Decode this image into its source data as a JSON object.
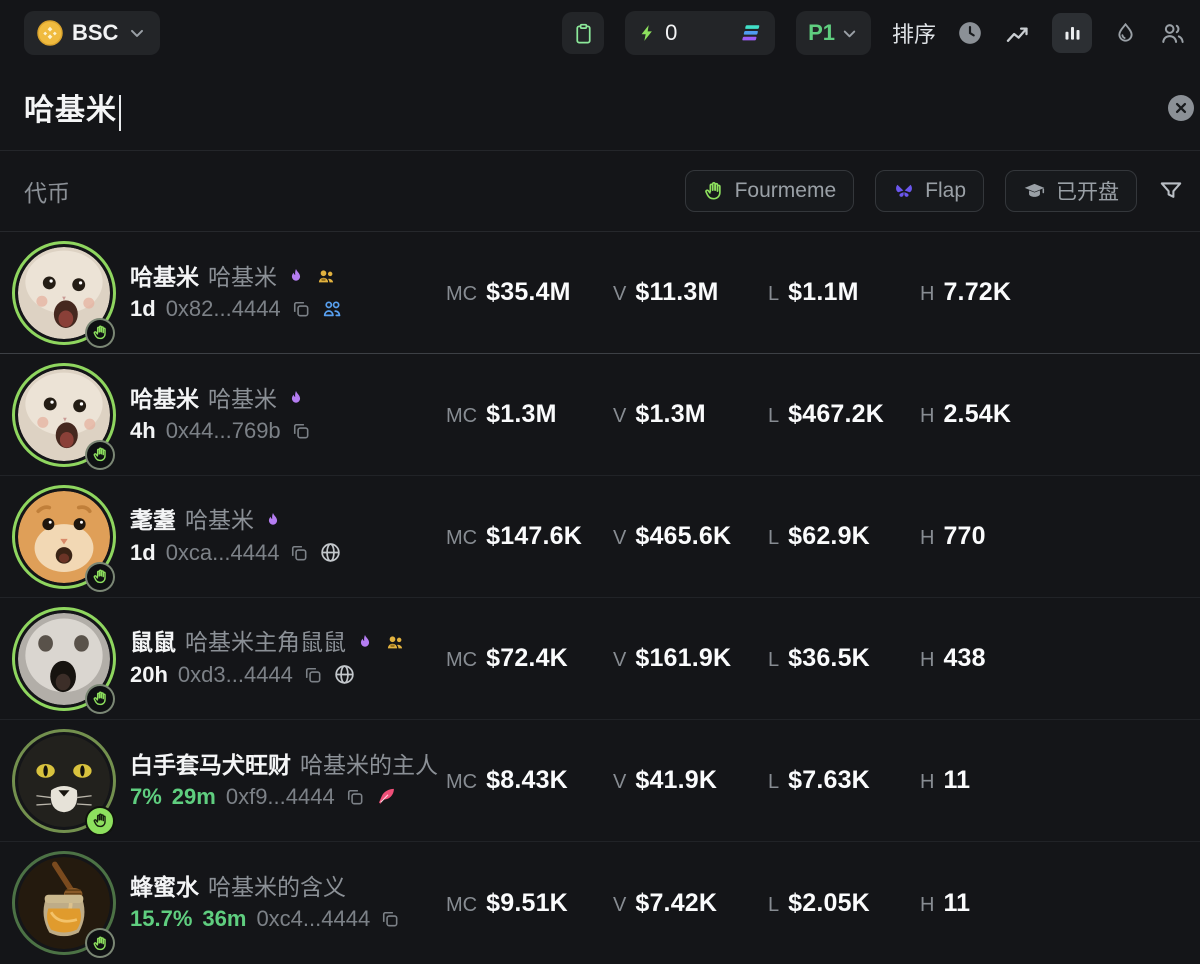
{
  "topbar": {
    "chain": "BSC",
    "boost_count": "0",
    "preset": "P1",
    "sort_label": "排序"
  },
  "search": {
    "value": "哈基米"
  },
  "section": {
    "title": "代币",
    "buttons": {
      "fourmeme": "Fourmeme",
      "flap": "Flap",
      "listed": "已开盘"
    }
  },
  "stats_labels": {
    "mc": "MC",
    "v": "V",
    "l": "L",
    "h": "H"
  },
  "tokens": [
    {
      "name": "哈基米",
      "subtitle": "哈基米",
      "age": "1d",
      "address": "0x82...4444",
      "mc": "$35.4M",
      "v": "$11.3M",
      "l": "$1.1M",
      "h": "7.72K",
      "badges": [
        "flame-icon",
        "holders-yellow-icon"
      ],
      "links": [
        "copy-icon",
        "community-blue-icon"
      ],
      "avatar": "white-cat"
    },
    {
      "name": "哈基米",
      "subtitle": "哈基米",
      "age": "4h",
      "address": "0x44...769b",
      "mc": "$1.3M",
      "v": "$1.3M",
      "l": "$467.2K",
      "h": "2.54K",
      "badges": [
        "flame-icon"
      ],
      "links": [
        "copy-icon"
      ],
      "avatar": "white-cat"
    },
    {
      "name": "耄耋",
      "subtitle": "哈基米",
      "age": "1d",
      "address": "0xca...4444",
      "mc": "$147.6K",
      "v": "$465.6K",
      "l": "$62.9K",
      "h": "770",
      "badges": [
        "flame-icon"
      ],
      "links": [
        "copy-icon",
        "website-globe-icon"
      ],
      "avatar": "orange-cat"
    },
    {
      "name": "鼠鼠",
      "subtitle": "哈基米主角鼠鼠",
      "age": "20h",
      "address": "0xd3...4444",
      "mc": "$72.4K",
      "v": "$161.9K",
      "l": "$36.5K",
      "h": "438",
      "badges": [
        "flame-icon",
        "holders-yellow-icon"
      ],
      "links": [
        "copy-icon",
        "website-globe-icon"
      ],
      "avatar": "hamster"
    },
    {
      "name": "白手套马犬旺财",
      "subtitle": "哈基米的主人",
      "pct": "7%",
      "age": "29m",
      "address": "0xf9...4444",
      "mc": "$8.43K",
      "v": "$41.9K",
      "l": "$7.63K",
      "h": "11",
      "badges": [],
      "links": [
        "copy-icon",
        "feather-pink-icon"
      ],
      "avatar": "tuxedo-cat"
    },
    {
      "name": "蜂蜜水",
      "subtitle": "哈基米的含义",
      "pct": "15.7%",
      "age": "36m",
      "address": "0xc4...4444",
      "mc": "$9.51K",
      "v": "$7.42K",
      "l": "$2.05K",
      "h": "11",
      "badges": [],
      "links": [
        "copy-icon"
      ],
      "avatar": "honey-jar"
    }
  ],
  "icons": {
    "bsc-coin-icon": "gold circle with diamond",
    "chevron-down-icon": "⌄",
    "clipboard-icon": "green clipboard outline",
    "lightning-icon": "green bolt ⚡",
    "solana-icon": "three skewed bars teal/blue/purple",
    "clock-icon": "filled gray clock",
    "line-chart-icon": "polyline trend",
    "bar-chart-icon": "three vertical bars (active)",
    "droplet-icon": "water drop outline",
    "people-icon": "two-person outline",
    "clear-x-icon": "gray circle ✕",
    "fourmeme-hand-icon": "green four-finger hand",
    "flap-butterfly-icon": "purple butterfly",
    "graduation-cap-icon": "gray graduation cap",
    "funnel-icon": "filter funnel outline",
    "flame-icon": "purple flame",
    "holders-yellow-icon": "two people filled yellow",
    "community-blue-icon": "two people outline blue",
    "copy-icon": "two stacked squares",
    "website-globe-icon": "globe outline",
    "feather-pink-icon": "pink quill"
  },
  "colors": {
    "background": "#141518",
    "pill": "#232528",
    "accent_green": "#5fce7f",
    "ring_green": "#8fd65f",
    "hand_green": "#8de05e",
    "flame_purple": "#b57df2",
    "holders_yellow": "#e2b23f",
    "community_blue": "#58a0f0",
    "feather_pink": "#ef4f78",
    "flap_purple": "#6b57ee",
    "text_gray": "#8b9096"
  }
}
